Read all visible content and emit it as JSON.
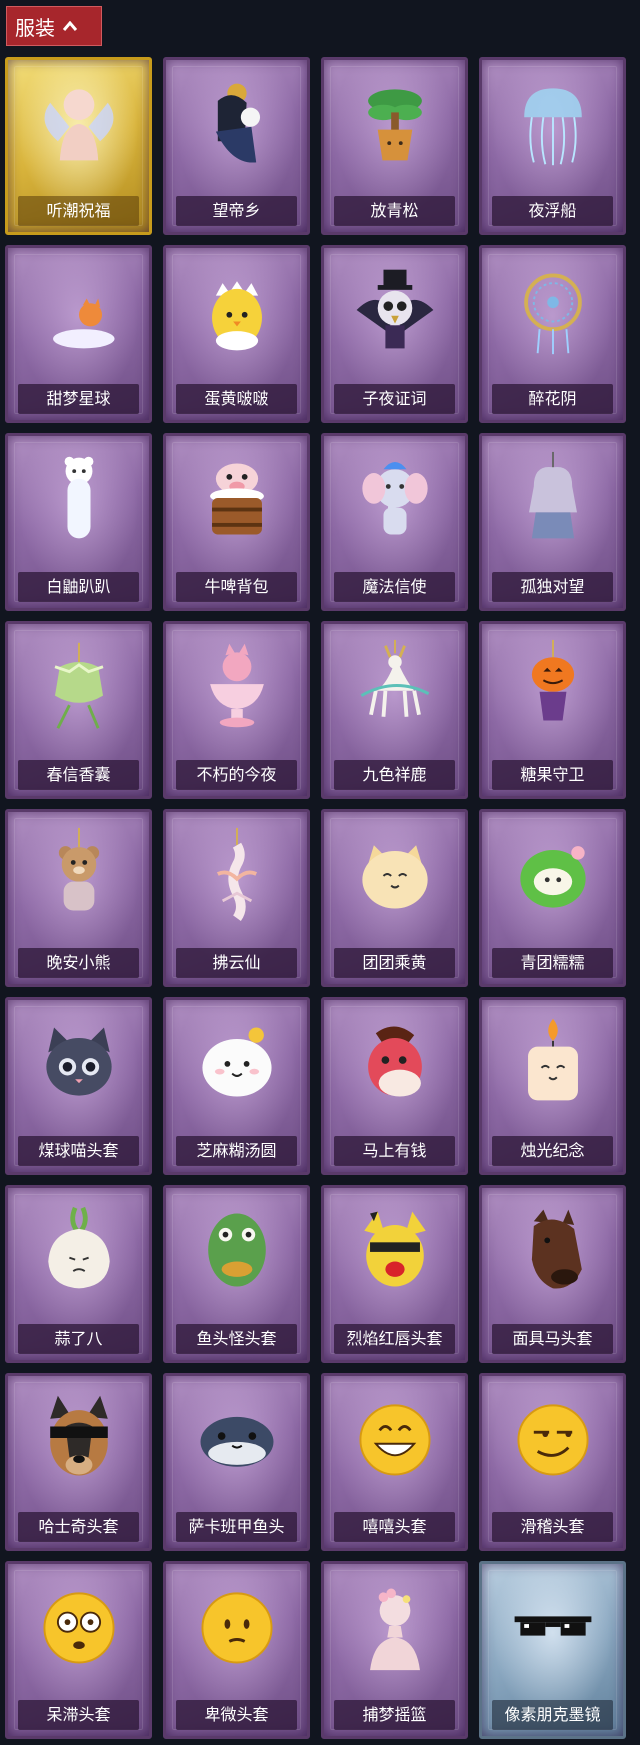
{
  "header": {
    "title": "服装",
    "arrow_icon": "chevron-up-icon",
    "color": "#a7262c"
  },
  "colors": {
    "page_bg": "#11151f",
    "card_purple": "#8e6aa6",
    "card_gold": "#d9b43c",
    "card_blue": "#8aa7c0"
  },
  "items": [
    {
      "label": "听潮祝福",
      "rarity": "gold",
      "icon": "angel-wings-figure-icon"
    },
    {
      "label": "望帝乡",
      "rarity": "purple",
      "icon": "character-with-mask-icon"
    },
    {
      "label": "放青松",
      "rarity": "purple",
      "icon": "potted-pine-icon"
    },
    {
      "label": "夜浮船",
      "rarity": "purple",
      "icon": "jellyfish-icon"
    },
    {
      "label": "甜梦星球",
      "rarity": "purple",
      "icon": "moon-fox-icon"
    },
    {
      "label": "蛋黄啵啵",
      "rarity": "purple",
      "icon": "egg-chick-icon"
    },
    {
      "label": "子夜证词",
      "rarity": "purple",
      "icon": "owl-top-hat-icon"
    },
    {
      "label": "醉花阴",
      "rarity": "purple",
      "icon": "dreamcatcher-icon"
    },
    {
      "label": "白鼬趴趴",
      "rarity": "purple",
      "icon": "white-ferret-icon"
    },
    {
      "label": "牛啤背包",
      "rarity": "purple",
      "icon": "cow-beer-barrel-icon"
    },
    {
      "label": "魔法信使",
      "rarity": "purple",
      "icon": "elephant-icon"
    },
    {
      "label": "孤独对望",
      "rarity": "purple",
      "icon": "doll-pendant-icon"
    },
    {
      "label": "春信香囊",
      "rarity": "purple",
      "icon": "sachet-icon"
    },
    {
      "label": "不朽的今夜",
      "rarity": "purple",
      "icon": "pink-fox-cup-icon"
    },
    {
      "label": "九色祥鹿",
      "rarity": "purple",
      "icon": "deer-pendant-icon"
    },
    {
      "label": "糖果守卫",
      "rarity": "purple",
      "icon": "pumpkin-pendant-icon"
    },
    {
      "label": "晚安小熊",
      "rarity": "purple",
      "icon": "teddy-bear-pendant-icon"
    },
    {
      "label": "拂云仙",
      "rarity": "purple",
      "icon": "crane-pendant-icon"
    },
    {
      "label": "团团乘黄",
      "rarity": "purple",
      "icon": "round-cat-icon"
    },
    {
      "label": "青团糯糯",
      "rarity": "purple",
      "icon": "green-mochi-icon"
    },
    {
      "label": "煤球喵头套",
      "rarity": "purple",
      "icon": "black-cat-head-icon"
    },
    {
      "label": "芝麻糊汤圆",
      "rarity": "purple",
      "icon": "white-dumpling-head-icon"
    },
    {
      "label": "马上有钱",
      "rarity": "purple",
      "icon": "red-horse-head-icon"
    },
    {
      "label": "烛光纪念",
      "rarity": "purple",
      "icon": "candle-head-icon"
    },
    {
      "label": "蒜了八",
      "rarity": "purple",
      "icon": "garlic-head-icon"
    },
    {
      "label": "鱼头怪头套",
      "rarity": "purple",
      "icon": "fish-head-icon"
    },
    {
      "label": "烈焰红唇头套",
      "rarity": "purple",
      "icon": "yellow-mouse-head-icon"
    },
    {
      "label": "面具马头套",
      "rarity": "purple",
      "icon": "horse-mask-icon"
    },
    {
      "label": "哈士奇头套",
      "rarity": "purple",
      "icon": "dog-sunglasses-head-icon"
    },
    {
      "label": "萨卡班甲鱼头",
      "rarity": "purple",
      "icon": "sacabambaspis-head-icon"
    },
    {
      "label": "嘻嘻头套",
      "rarity": "purple",
      "icon": "grinning-emoji-head-icon"
    },
    {
      "label": "滑稽头套",
      "rarity": "purple",
      "icon": "smirk-emoji-head-icon"
    },
    {
      "label": "呆滞头套",
      "rarity": "purple",
      "icon": "dazed-emoji-head-icon"
    },
    {
      "label": "卑微头套",
      "rarity": "purple",
      "icon": "humble-emoji-head-icon"
    },
    {
      "label": "捕梦摇篮",
      "rarity": "purple",
      "icon": "mannequin-flowers-icon"
    },
    {
      "label": "像素朋克墨镜",
      "rarity": "blue",
      "icon": "pixel-sunglasses-icon"
    }
  ]
}
